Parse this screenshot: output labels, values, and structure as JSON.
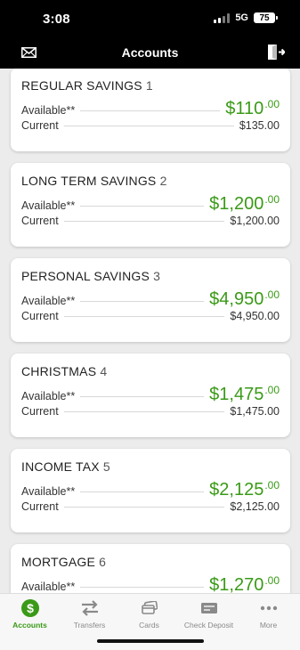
{
  "status_bar": {
    "time": "3:08",
    "network": "5G",
    "battery": "75"
  },
  "header": {
    "title": "Accounts"
  },
  "accounts": [
    {
      "name": "REGULAR SAVINGS",
      "number": "1",
      "available_label": "Available**",
      "available_dollars": "$110",
      "available_cents": ".00",
      "current_label": "Current",
      "current": "$135.00"
    },
    {
      "name": "LONG TERM SAVINGS",
      "number": "2",
      "available_label": "Available**",
      "available_dollars": "$1,200",
      "available_cents": ".00",
      "current_label": "Current",
      "current": "$1,200.00"
    },
    {
      "name": "PERSONAL SAVINGS",
      "number": "3",
      "available_label": "Available**",
      "available_dollars": "$4,950",
      "available_cents": ".00",
      "current_label": "Current",
      "current": "$4,950.00"
    },
    {
      "name": "CHRISTMAS",
      "number": "4",
      "available_label": "Available**",
      "available_dollars": "$1,475",
      "available_cents": ".00",
      "current_label": "Current",
      "current": "$1,475.00"
    },
    {
      "name": "INCOME TAX",
      "number": "5",
      "available_label": "Available**",
      "available_dollars": "$2,125",
      "available_cents": ".00",
      "current_label": "Current",
      "current": "$2,125.00"
    },
    {
      "name": "MORTGAGE",
      "number": "6",
      "available_label": "Available**",
      "available_dollars": "$1,270",
      "available_cents": ".00",
      "current_label": "Current",
      "current": ""
    }
  ],
  "tabs": [
    {
      "label": "Accounts",
      "icon": "dollar-circle-icon",
      "active": true
    },
    {
      "label": "Transfers",
      "icon": "transfer-arrows-icon",
      "active": false
    },
    {
      "label": "Cards",
      "icon": "cards-icon",
      "active": false
    },
    {
      "label": "Check Deposit",
      "icon": "check-icon",
      "active": false
    },
    {
      "label": "More",
      "icon": "more-dots-icon",
      "active": false
    }
  ],
  "colors": {
    "accent_green": "#3a9a17",
    "header_bg": "#000000"
  }
}
